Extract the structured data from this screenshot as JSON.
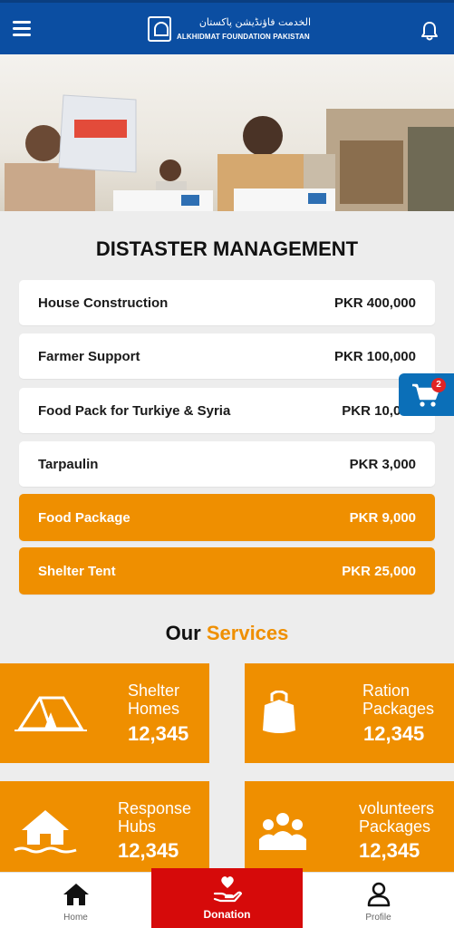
{
  "header": {
    "logo_urdu": "الخدمت فاؤنڈیشن پاکستان",
    "logo_english": "ALKHIDMAT FOUNDATION PAKISTAN"
  },
  "section_title": "DISTASTER MANAGEMENT",
  "items": [
    {
      "name": "House Construction",
      "price": "PKR 400,000"
    },
    {
      "name": "Farmer Support",
      "price": "PKR 100,000"
    },
    {
      "name": "Food Pack for Turkiye & Syria",
      "price": "PKR 10,000"
    },
    {
      "name": "Tarpaulin",
      "price": "PKR 3,000"
    },
    {
      "name": "Food Package",
      "price": "PKR 9,000"
    },
    {
      "name": "Shelter Tent",
      "price": "PKR 25,000"
    }
  ],
  "cart": {
    "badge": "2"
  },
  "services": {
    "title_prefix": "Our",
    "title_accent": "Services",
    "cards": [
      {
        "label_line1": "Shelter",
        "label_line2": "Homes",
        "count": "12,345",
        "icon": "tent-icon"
      },
      {
        "label_line1": "Ration",
        "label_line2": "Packages",
        "count": "12,345",
        "icon": "ration-bag-icon"
      },
      {
        "label_line1": "Response",
        "label_line2": "Hubs",
        "count": "12,345",
        "icon": "flood-house-icon"
      },
      {
        "label_line1": "volunteers",
        "label_line2": "Packages",
        "count": "12,345",
        "icon": "people-group-icon"
      }
    ]
  },
  "bottom_nav": {
    "home": "Home",
    "donation": "Donation",
    "profile": "Profile"
  },
  "colors": {
    "header_blue": "#0b4ea2",
    "accent_orange": "#ef8f00",
    "donation_red": "#d60a0a",
    "cart_blue": "#0b6fb8"
  }
}
